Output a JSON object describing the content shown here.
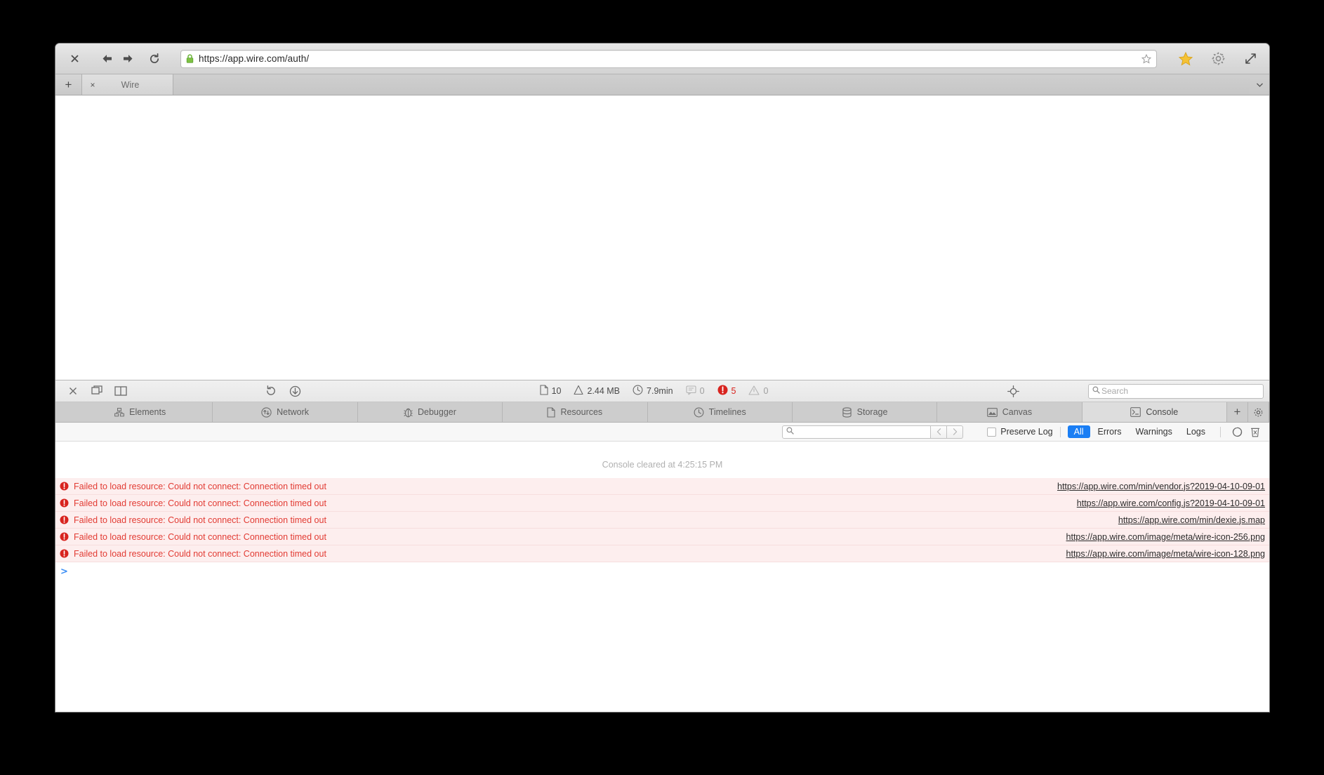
{
  "browser": {
    "url": "https://app.wire.com/auth/",
    "lock_icon": "lock-icon",
    "nav": {
      "close_label": "×",
      "back_icon": "arrow-left-icon",
      "forward_icon": "arrow-right-icon",
      "reload_icon": "reload-icon",
      "bookmark_star_icon": "star-outline-icon",
      "favorites_icon": "star-filled-icon",
      "settings_icon": "gear-icon",
      "fullscreen_icon": "expand-icon"
    },
    "tabs": {
      "new_tab_label": "+",
      "close_label": "×",
      "menu_icon": "chevron-down-icon",
      "items": [
        {
          "label": "Wire",
          "active": true
        }
      ]
    }
  },
  "inspector": {
    "toolbar": {
      "close_icon": "close-icon",
      "dock_bottom_icon": "dock-window-icon",
      "dock_side_icon": "dock-split-icon",
      "reload_icon": "reload-page-icon",
      "download_icon": "download-icon",
      "inspect_icon": "crosshair-icon",
      "search_placeholder": "Search",
      "stats": [
        {
          "name": "resources",
          "icon": "document-icon",
          "value": "10",
          "state": "normal"
        },
        {
          "name": "transfer-size",
          "icon": "bag-icon",
          "value": "2.44 MB",
          "state": "normal"
        },
        {
          "name": "load-time",
          "icon": "clock-icon",
          "value": "7.9min",
          "state": "normal"
        },
        {
          "name": "messages",
          "icon": "message-icon",
          "value": "0",
          "state": "dim"
        },
        {
          "name": "errors",
          "icon": "error-icon",
          "value": "5",
          "state": "error"
        },
        {
          "name": "warnings",
          "icon": "warning-icon",
          "value": "0",
          "state": "dim"
        }
      ]
    },
    "tabs": {
      "add_label": "+",
      "settings_icon": "gear-icon",
      "items": [
        {
          "label": "Elements",
          "icon": "elements-icon",
          "active": false
        },
        {
          "label": "Network",
          "icon": "network-icon",
          "active": false
        },
        {
          "label": "Debugger",
          "icon": "debugger-icon",
          "active": false
        },
        {
          "label": "Resources",
          "icon": "resources-icon",
          "active": false
        },
        {
          "label": "Timelines",
          "icon": "timelines-icon",
          "active": false
        },
        {
          "label": "Storage",
          "icon": "storage-icon",
          "active": false
        },
        {
          "label": "Canvas",
          "icon": "canvas-icon",
          "active": false
        },
        {
          "label": "Console",
          "icon": "console-icon",
          "active": true
        }
      ]
    },
    "console": {
      "filter": {
        "search_placeholder": "",
        "search_icon": "search-icon",
        "prev_icon": "chevron-left-icon",
        "next_icon": "chevron-right-icon",
        "preserve_log_label": "Preserve Log",
        "preserve_log_checked": false,
        "levels": [
          {
            "label": "All",
            "active": true
          },
          {
            "label": "Errors",
            "active": false
          },
          {
            "label": "Warnings",
            "active": false
          },
          {
            "label": "Logs",
            "active": false
          }
        ],
        "split_icon": "split-console-icon",
        "clear_icon": "trash-icon"
      },
      "cleared_notice": "Console cleared at 4:25:15 PM",
      "prompt": ">",
      "messages": [
        {
          "level": "error",
          "icon": "error-icon",
          "text": "Failed to load resource: Could not connect: Connection timed out",
          "source": "https://app.wire.com/min/vendor.js?2019-04-10-09-01"
        },
        {
          "level": "error",
          "icon": "error-icon",
          "text": "Failed to load resource: Could not connect: Connection timed out",
          "source": "https://app.wire.com/config.js?2019-04-10-09-01"
        },
        {
          "level": "error",
          "icon": "error-icon",
          "text": "Failed to load resource: Could not connect: Connection timed out",
          "source": "https://app.wire.com/min/dexie.js.map"
        },
        {
          "level": "error",
          "icon": "error-icon",
          "text": "Failed to load resource: Could not connect: Connection timed out",
          "source": "https://app.wire.com/image/meta/wire-icon-256.png"
        },
        {
          "level": "error",
          "icon": "error-icon",
          "text": "Failed to load resource: Could not connect: Connection timed out",
          "source": "https://app.wire.com/image/meta/wire-icon-128.png"
        }
      ]
    }
  },
  "colors": {
    "accent_blue": "#1a7ef4",
    "error_red": "#d8241f",
    "error_row_bg": "#fdeeee",
    "prompt_blue": "#3b8ef5"
  }
}
